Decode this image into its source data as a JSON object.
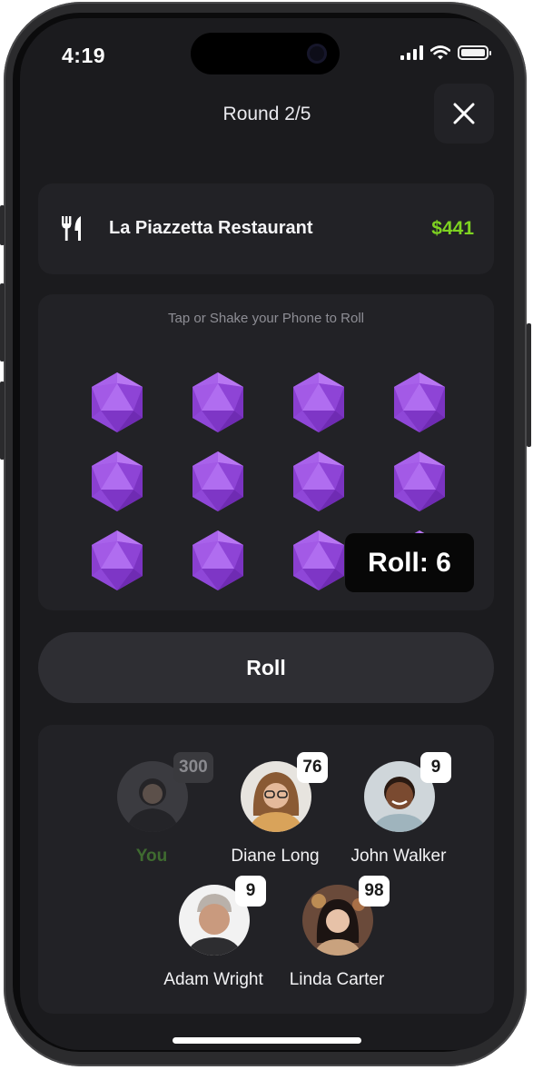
{
  "status_bar": {
    "time": "4:19"
  },
  "header": {
    "title": "Round 2/5"
  },
  "restaurant": {
    "name": "La Piazzetta Restaurant",
    "amount": "$441"
  },
  "dice": {
    "hint": "Tap or Shake your Phone to Roll",
    "count": 12,
    "color": "#9b4fe0"
  },
  "roll_tooltip": "Roll: 6",
  "roll_button": "Roll",
  "players": [
    {
      "name": "You",
      "score": "300",
      "active": false
    },
    {
      "name": "Diane Long",
      "score": "76",
      "active": true
    },
    {
      "name": "John Walker",
      "score": "9",
      "active": true
    },
    {
      "name": "Adam Wright",
      "score": "9",
      "active": true
    },
    {
      "name": "Linda Carter",
      "score": "98",
      "active": true
    }
  ],
  "colors": {
    "accent_green": "#7ed321",
    "background": "#1b1b1e",
    "card": "#222226"
  }
}
